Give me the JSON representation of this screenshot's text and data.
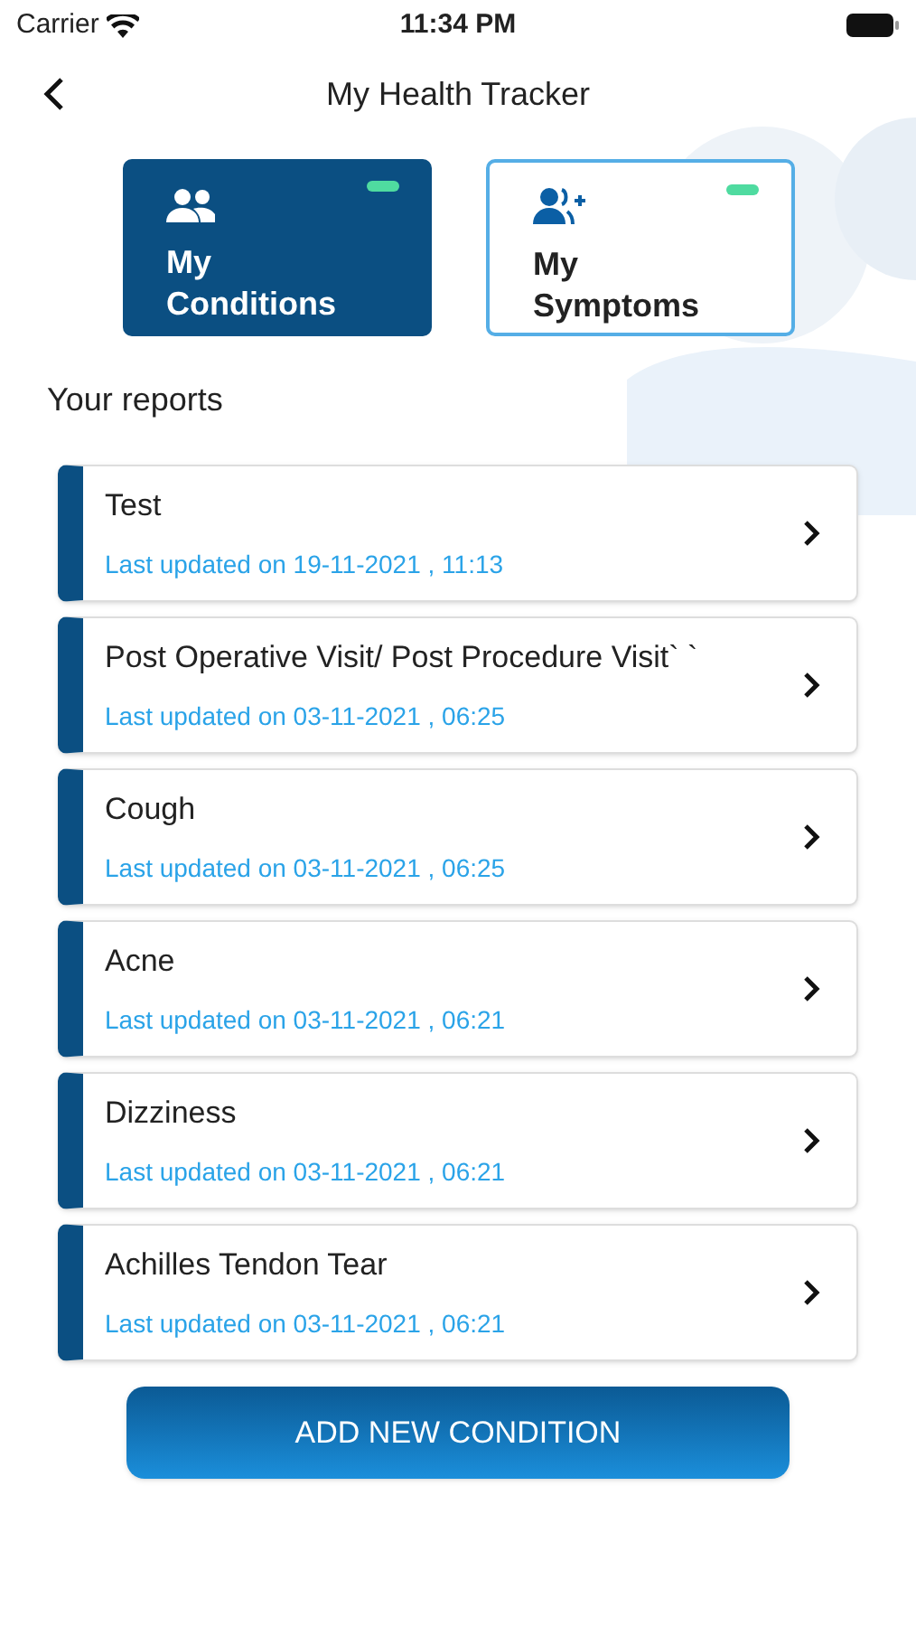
{
  "status_bar": {
    "carrier": "Carrier",
    "time": "11:34 PM"
  },
  "header": {
    "title": "My Health Tracker"
  },
  "tabs": [
    {
      "kind": "conditions",
      "line1": "My",
      "line2": "Conditions",
      "selected": true
    },
    {
      "kind": "symptoms",
      "line1": "My",
      "line2": "Symptoms",
      "selected": false
    }
  ],
  "section_title": "Your reports",
  "reports": [
    {
      "title": "Test",
      "updated": "Last updated on 19-11-2021 , 11:13"
    },
    {
      "title": "Post Operative Visit/ Post Procedure Visit` `",
      "updated": "Last updated on 03-11-2021 , 06:25"
    },
    {
      "title": "Cough",
      "updated": "Last updated on 03-11-2021 , 06:25"
    },
    {
      "title": "Acne",
      "updated": "Last updated on 03-11-2021 , 06:21"
    },
    {
      "title": "Dizziness",
      "updated": "Last updated on 03-11-2021 , 06:21"
    },
    {
      "title": "Achilles Tendon Tear",
      "updated": "Last updated on 03-11-2021 , 06:21"
    }
  ],
  "add_button": "ADD NEW CONDITION"
}
